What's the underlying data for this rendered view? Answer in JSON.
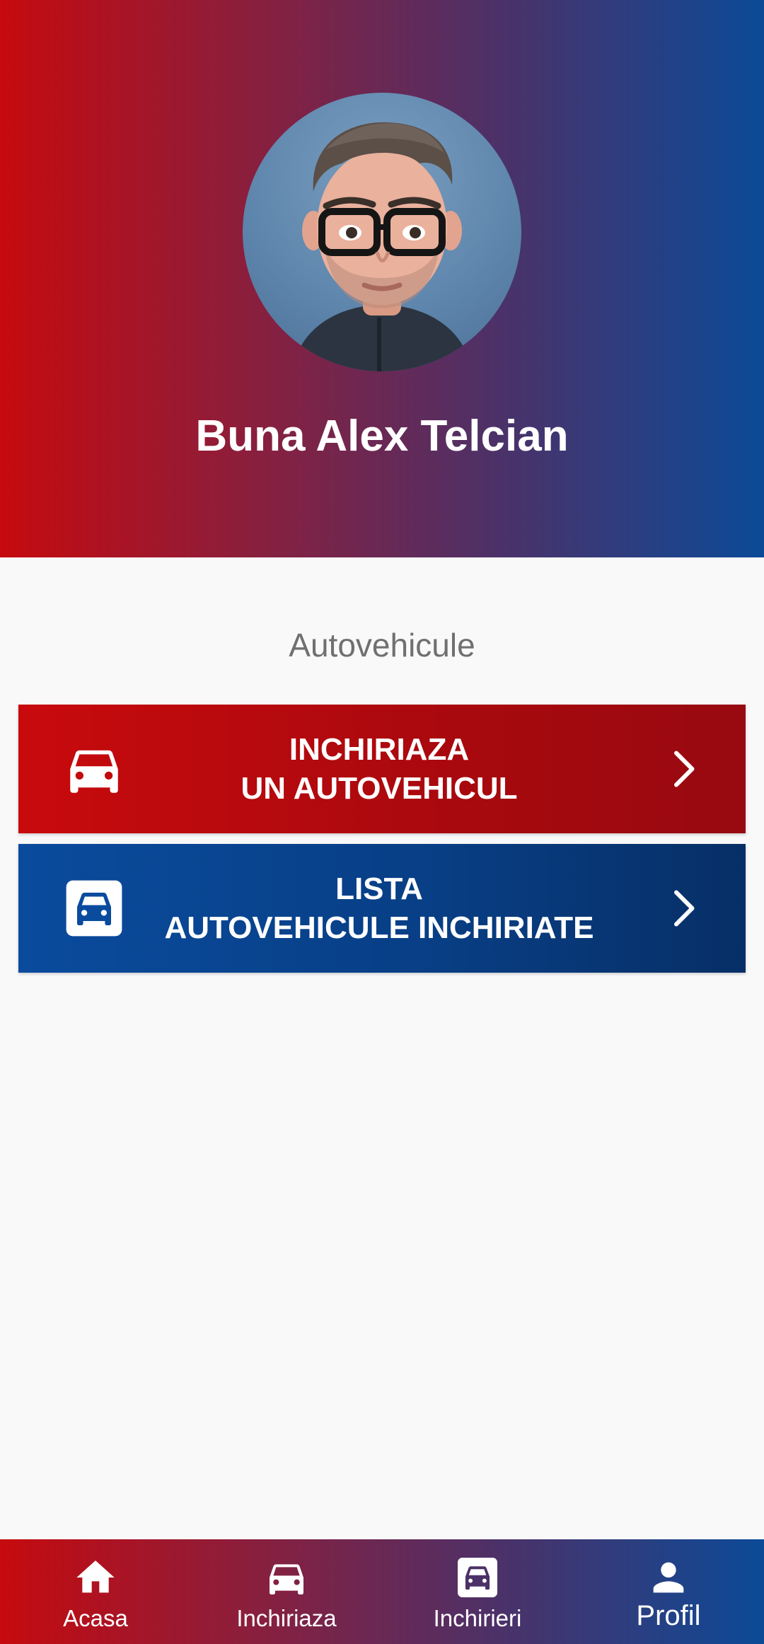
{
  "header": {
    "greeting": "Buna Alex Telcian"
  },
  "main": {
    "section_title": "Autovehicule",
    "actions": [
      {
        "icon": "car-icon",
        "line1": "INCHIRIAZA",
        "line2": "UN AUTOVEHICUL",
        "color": "#c80a0d"
      },
      {
        "icon": "car-box-icon",
        "line1": "LISTA",
        "line2": "AUTOVEHICULE INCHIRIATE",
        "color": "#0a4b9d"
      }
    ]
  },
  "bottom_nav": {
    "items": [
      {
        "label": "Acasa",
        "icon": "home-icon"
      },
      {
        "label": "Inchiriaza",
        "icon": "car-icon"
      },
      {
        "label": "Inchirieri",
        "icon": "car-box-icon"
      },
      {
        "label": "Profil",
        "icon": "person-icon",
        "active": true
      }
    ]
  },
  "colors": {
    "gradient_start": "#c60a0e",
    "gradient_end": "#0c4a97",
    "background": "#f9f9fa",
    "section_title": "#707070"
  }
}
